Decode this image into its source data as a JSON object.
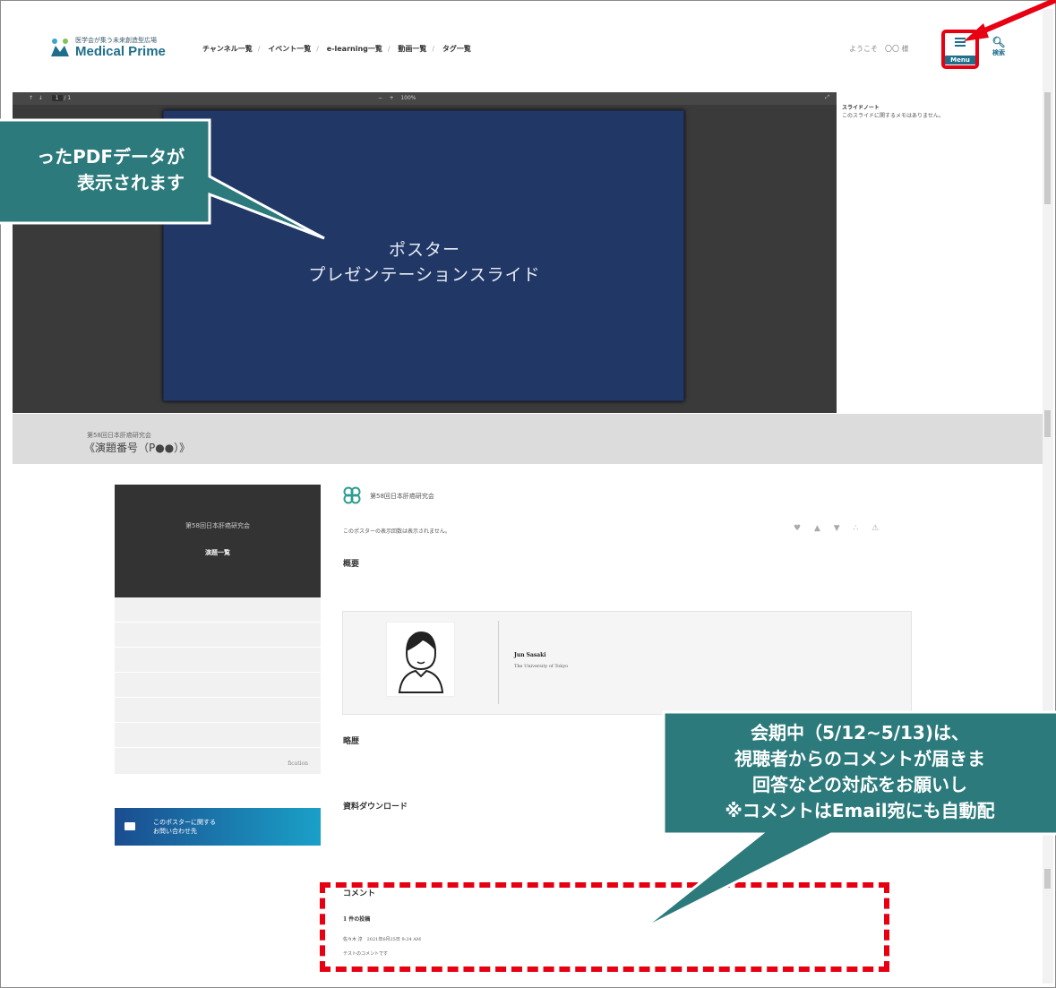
{
  "header": {
    "logo_small": "医学会が集う未来創造型広場",
    "logo_big": "Medical Prime",
    "nav": [
      "チャンネル一覧",
      "イベント一覧",
      "e-learning一覧",
      "動画一覧",
      "タグ一覧"
    ],
    "welcome": "ようこそ　〇〇 様",
    "menu_label": "Menu",
    "search_label": "検索"
  },
  "viewer": {
    "page_current": "1",
    "page_total": "/ 1",
    "zoom": "100%",
    "slide_line1": "ポスター",
    "slide_line2": "プレゼンテーションスライド"
  },
  "notes": {
    "title": "スライドノート",
    "text": "このスライドに関するメモはありません。"
  },
  "band": {
    "subtitle": "第58回日本肝癌研究会",
    "title": "《演題番号（P●●）》"
  },
  "sidebar": {
    "event_name": "第58回日本肝癌研究会",
    "list_link": "演題一覧",
    "footer_text": "fication",
    "contact_line1": "このポスターに関する",
    "contact_line2": "お問い合わせ先"
  },
  "main": {
    "society_name": "第58回日本肝癌研究会",
    "views_note": "このポスターの表示回数は表示されません。",
    "summary_heading": "概要",
    "author_name": "Jun Sasaki",
    "author_affiliation": "The University of Tokyo",
    "bio_heading": "略歴",
    "download_heading": "資料ダウンロード"
  },
  "comments": {
    "heading": "コメント",
    "count": "1 件の投稿",
    "meta": "佐々木 淳　2021年6月25日 9:24 AM",
    "body": "テストのコメントです"
  },
  "callouts": {
    "upload_line1": "ったPDFデータが",
    "upload_line2": "表示されます",
    "comment_line1": "会期中（5/12~5/13)は、",
    "comment_line2": "視聴者からのコメントが届きま",
    "comment_line3": "回答などの対応をお願いし",
    "comment_line4": "※コメントはEmail宛にも自動配"
  },
  "colors": {
    "brand": "#1f6f8b",
    "callout": "#2c7a7b",
    "highlight": "#e60012",
    "slide_bg": "#213866"
  }
}
